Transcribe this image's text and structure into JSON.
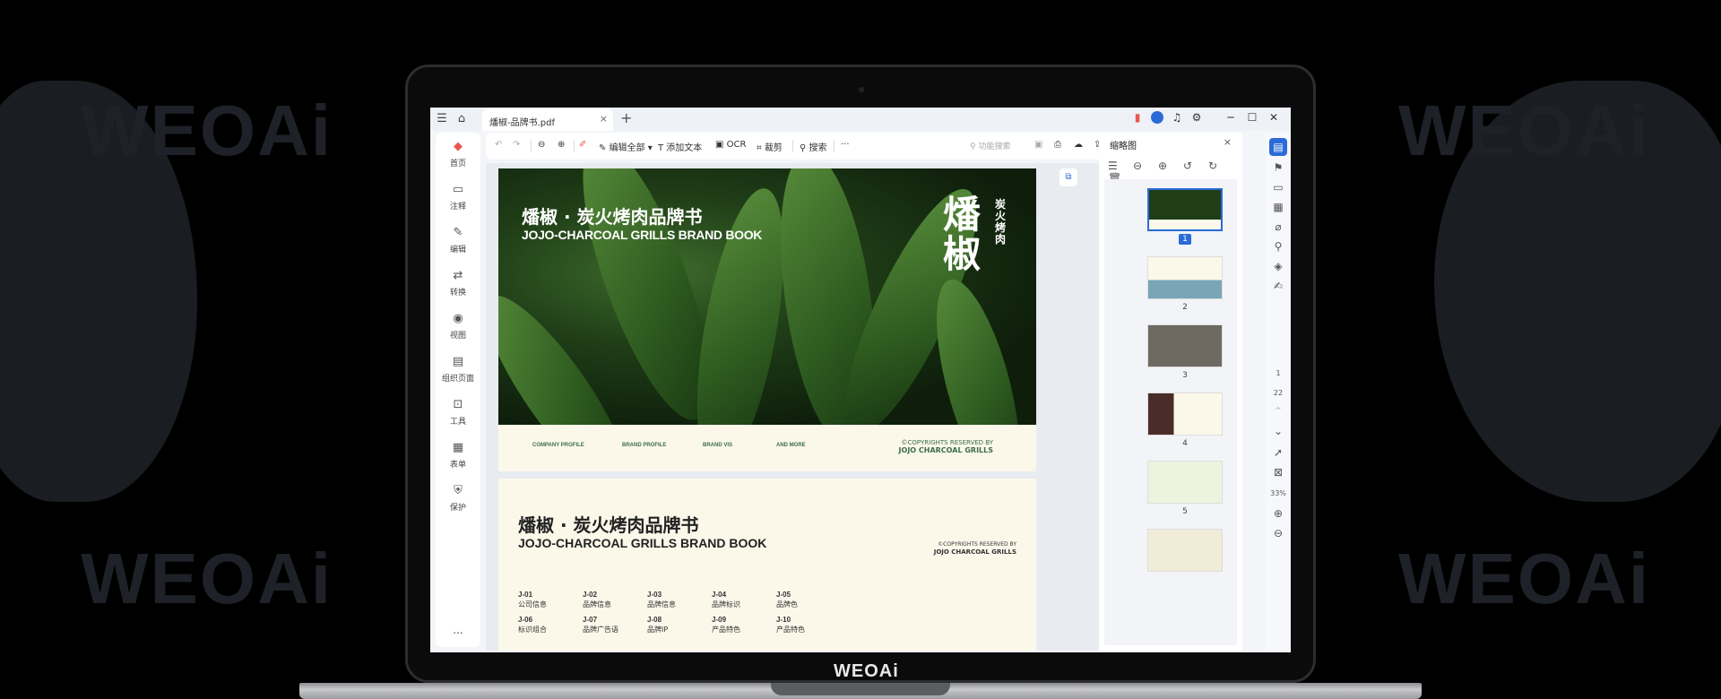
{
  "background": {
    "brand": "WEOAi"
  },
  "laptop": {
    "brand": "WEOAi"
  },
  "titlebar": {
    "tab_title": "燔椒-品牌书.pdf",
    "tab_close": "×",
    "new_tab": "+"
  },
  "leftnav": {
    "items": [
      {
        "label": "首页",
        "icon": "home-icon"
      },
      {
        "label": "注释",
        "icon": "comment-icon"
      },
      {
        "label": "编辑",
        "icon": "edit-icon"
      },
      {
        "label": "转换",
        "icon": "convert-icon"
      },
      {
        "label": "视图",
        "icon": "view-icon"
      },
      {
        "label": "组织页面",
        "icon": "pages-icon"
      },
      {
        "label": "工具",
        "icon": "tools-icon"
      },
      {
        "label": "表单",
        "icon": "form-icon"
      },
      {
        "label": "保护",
        "icon": "shield-icon"
      }
    ],
    "more": "..."
  },
  "toolbar": {
    "edit_all": "编辑全部",
    "add_text": "添加文本",
    "ocr": "OCR",
    "crop": "裁剪",
    "search": "搜索",
    "more": "···",
    "feature_search_placeholder": "功能搜索"
  },
  "document": {
    "page1": {
      "title_cn": "燔椒 · 炭火烤肉品牌书",
      "title_en": "JOJO-CHARCOAL GRILLS BRAND BOOK",
      "logo_main": "燔椒",
      "logo_side": "炭火烤肉",
      "footer_tabs": [
        "COMPANY PROFILE",
        "BRAND PROFILE",
        "BRAND VIS",
        "AND MORE"
      ],
      "copyright_line1": "©COPYRIGHTS RESERVED BY",
      "copyright_line2": "JOJO CHARCOAL GRILLS"
    },
    "page2": {
      "title_cn": "燔椒 · 炭火烤肉品牌书",
      "title_en": "JOJO-CHARCOAL GRILLS BRAND BOOK",
      "copyright_line1": "©COPYRIGHTS RESERVED BY",
      "copyright_line2": "JOJO CHARCOAL GRILLS",
      "index": [
        {
          "code": "J-01",
          "label": "公司信息"
        },
        {
          "code": "J-02",
          "label": "品牌信息"
        },
        {
          "code": "J-03",
          "label": "品牌信息"
        },
        {
          "code": "J-04",
          "label": "品牌标识"
        },
        {
          "code": "J-05",
          "label": "品牌色"
        },
        {
          "code": "J-06",
          "label": "标识组合"
        },
        {
          "code": "J-07",
          "label": "品牌广告语"
        },
        {
          "code": "J-08",
          "label": "品牌IP"
        },
        {
          "code": "J-09",
          "label": "产品特色"
        },
        {
          "code": "J-10",
          "label": "产品特色"
        }
      ]
    }
  },
  "thumbnails": {
    "title": "缩略图",
    "close": "×",
    "pages": [
      "1",
      "2",
      "3",
      "4",
      "5"
    ],
    "selected": "1"
  },
  "rightbar": {
    "current_page": "1",
    "total_pages": "22",
    "zoom": "33%"
  },
  "colors": {
    "accent": "#2a6bd8",
    "brand_green": "#3c6e47",
    "page_bg": "#fbf8ea"
  }
}
